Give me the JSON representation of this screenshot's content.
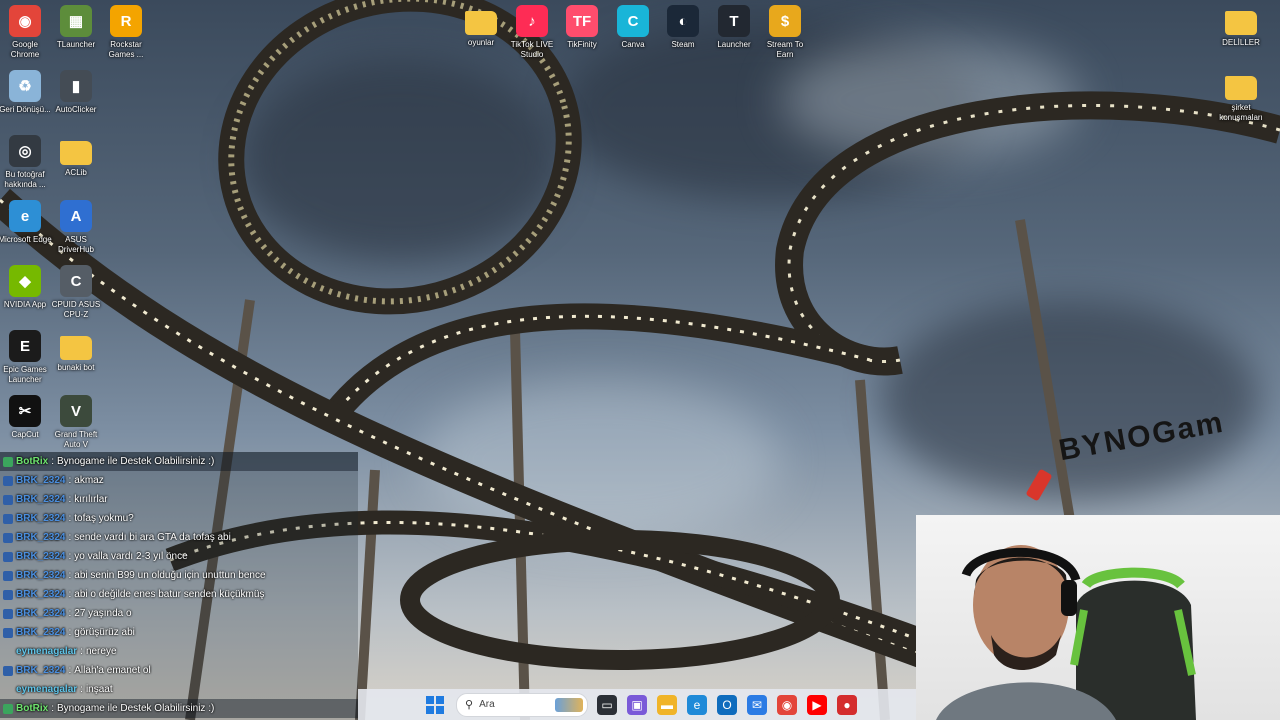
{
  "desktop": {
    "icons_left": [
      {
        "label": "Google Chrome",
        "icon": "chrome-icon",
        "color": "#e3453a"
      },
      {
        "label": "TLauncher",
        "icon": "minecraft-grass-icon",
        "color": "#5d8d3b"
      },
      {
        "label": "Rockstar Games ...",
        "icon": "rockstar-icon",
        "color": "#f4a400"
      },
      {
        "label": "Geri Dönüşü...",
        "icon": "recycle-bin-icon",
        "color": "#8ab4d8"
      },
      {
        "label": "AutoClicker",
        "icon": "mouse-icon",
        "color": "#444c55"
      },
      {
        "label": "Bu fotoğraf hakkında ...",
        "icon": "camera-icon",
        "color": "#333a42"
      },
      {
        "label": "ACLib",
        "icon": "folder-icon",
        "color": "#f4c542"
      },
      {
        "label": "Microsoft Edge",
        "icon": "edge-icon",
        "color": "#2d8fd5"
      },
      {
        "label": "ASUS DriverHub",
        "icon": "asus-icon",
        "color": "#2f6fd1"
      },
      {
        "label": "NVIDIA App",
        "icon": "nvidia-icon",
        "color": "#76b900"
      },
      {
        "label": "CPUID ASUS CPU-Z",
        "icon": "cpuz-icon",
        "color": "#555d66"
      },
      {
        "label": "Epic Games Launcher",
        "icon": "epic-games-icon",
        "color": "#1b1b1b"
      },
      {
        "label": "bunaki bot",
        "icon": "folder-icon",
        "color": "#f4c542"
      },
      {
        "label": "CapCut",
        "icon": "capcut-icon",
        "color": "#111111"
      },
      {
        "label": "Grand Theft Auto V",
        "icon": "gta-icon",
        "color": "#3c4a3c"
      }
    ],
    "icons_top": [
      {
        "label": "oyunlar",
        "icon": "folder-icon",
        "color": "#f4c542"
      },
      {
        "label": "TikTok LIVE Studio",
        "icon": "tiktok-icon",
        "color": "#fe2c55"
      },
      {
        "label": "TikFinity",
        "icon": "tikfinity-icon",
        "color": "#ff4d6d"
      },
      {
        "label": "Canva",
        "icon": "canva-icon",
        "color": "#19b5d8"
      },
      {
        "label": "Steam",
        "icon": "steam-icon",
        "color": "#1b2838"
      },
      {
        "label": "Launcher",
        "icon": "tiktok-launcher-icon",
        "color": "#222831"
      },
      {
        "label": "Stream To Earn",
        "icon": "stream-to-earn-icon",
        "color": "#e8a81c"
      }
    ],
    "icons_right": [
      {
        "label": "DELİLLER",
        "icon": "folder-icon",
        "color": "#f4c542"
      },
      {
        "label": "şirket konuşmaları",
        "icon": "folder-icon",
        "color": "#f4c542"
      }
    ]
  },
  "watermark": {
    "text": "BYNOGam",
    "accent": "#d9362b"
  },
  "chat": {
    "messages": [
      {
        "user": "BotRix",
        "text": "Bynogame ile Destek Olabilirsiniz :)",
        "user_color": "#6ee36e",
        "badge": "#3ba55d",
        "bot": true
      },
      {
        "user": "BRK_2324",
        "text": "akmaz",
        "user_color": "#4a8fe0",
        "badge": "#2f5fa8"
      },
      {
        "user": "BRK_2324",
        "text": "kırılırlar",
        "user_color": "#4a8fe0",
        "badge": "#2f5fa8"
      },
      {
        "user": "BRK_2324",
        "text": "tofaş yokmu?",
        "user_color": "#4a8fe0",
        "badge": "#2f5fa8"
      },
      {
        "user": "BRK_2324",
        "text": "sende vardı bi ara GTA da tofaş abi",
        "user_color": "#4a8fe0",
        "badge": "#2f5fa8"
      },
      {
        "user": "BRK_2324",
        "text": "yo valla vardı 2-3 yıl önce",
        "user_color": "#4a8fe0",
        "badge": "#2f5fa8"
      },
      {
        "user": "BRK_2324",
        "text": "abi senin B99 un olduğu için unuttun bence",
        "user_color": "#4a8fe0",
        "badge": "#2f5fa8"
      },
      {
        "user": "BRK_2324",
        "text": "abi o değilde enes batur senden küçükmüş",
        "user_color": "#4a8fe0",
        "badge": "#2f5fa8"
      },
      {
        "user": "BRK_2324",
        "text": "27 yaşında o",
        "user_color": "#4a8fe0",
        "badge": "#2f5fa8"
      },
      {
        "user": "BRK_2324",
        "text": "görüşürüz abi",
        "user_color": "#4a8fe0",
        "badge": "#2f5fa8"
      },
      {
        "user": "eymenagalar",
        "text": "nereye",
        "user_color": "#5fc4e8",
        "badge": ""
      },
      {
        "user": "BRK_2324",
        "text": "Allah'a emanet ol",
        "user_color": "#4a8fe0",
        "badge": "#2f5fa8"
      },
      {
        "user": "eymenagalar",
        "text": "inşaat",
        "user_color": "#5fc4e8",
        "badge": ""
      },
      {
        "user": "BotRix",
        "text": "Bynogame ile Destek Olabilirsiniz :)",
        "user_color": "#6ee36e",
        "badge": "#3ba55d",
        "bot": true
      }
    ]
  },
  "taskbar": {
    "search_placeholder": "Ara",
    "apps": [
      {
        "icon": "task-view-icon",
        "color": "#2b2f36"
      },
      {
        "icon": "ms-store-icon",
        "color": "#7a5ad8"
      },
      {
        "icon": "file-explorer-icon",
        "color": "#f0b429"
      },
      {
        "icon": "edge-icon",
        "color": "#1f8ad8"
      },
      {
        "icon": "outlook-icon",
        "color": "#0f6cbd"
      },
      {
        "icon": "mail-icon",
        "color": "#2b7be4"
      },
      {
        "icon": "chrome-icon",
        "color": "#e3453a"
      },
      {
        "icon": "youtube-icon",
        "color": "#ff0000"
      },
      {
        "icon": "app-icon",
        "color": "#d42d2d"
      }
    ]
  }
}
